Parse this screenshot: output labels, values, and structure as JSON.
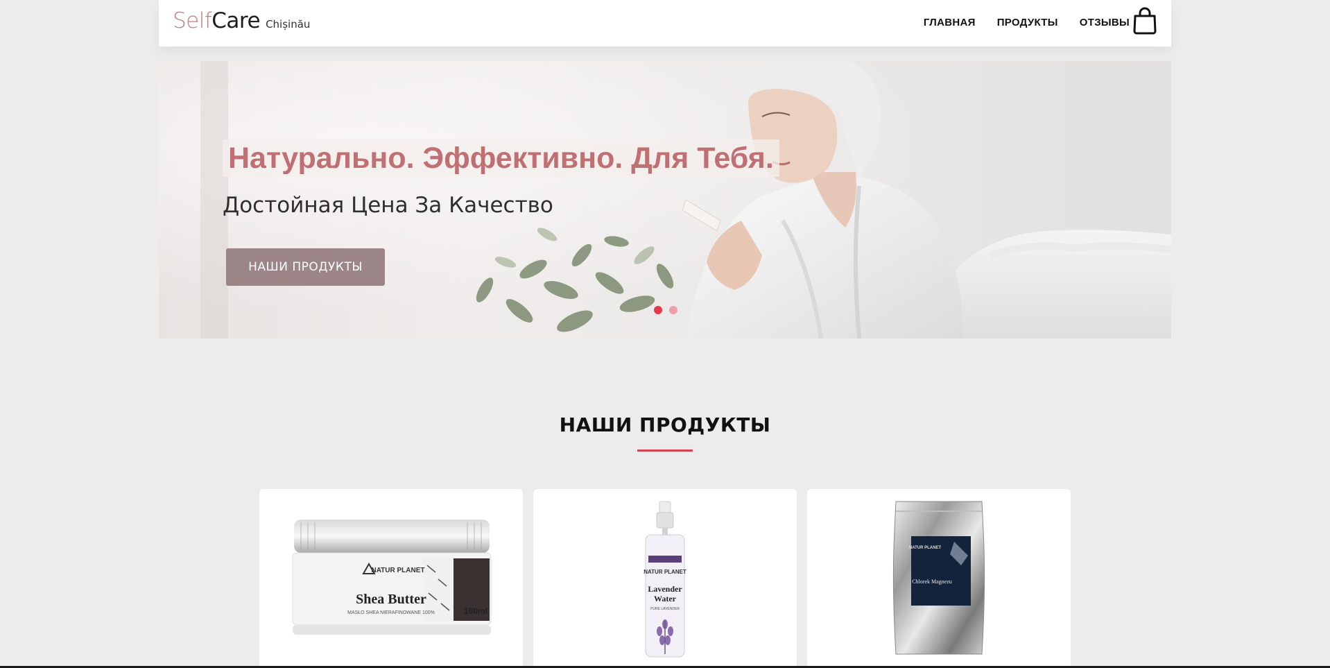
{
  "header": {
    "logo_self": "Self",
    "logo_care": "Care",
    "logo_city": "Chișinău",
    "nav": [
      "ГЛАВНАЯ",
      "ПРОДУКТЫ",
      "ОТЗЫВЫ"
    ],
    "cart_icon": "shopping-bag-icon"
  },
  "hero": {
    "title": "Натурально. Эффективно. Для Тебя.",
    "subtitle": "Достойная Цена За Качество",
    "button": "НАШИ ПРОДУКТЫ",
    "slides_total": 2,
    "active_slide": 1
  },
  "products_section": {
    "title": "НАШИ ПРОДУКТЫ"
  },
  "products": [
    {
      "brand": "NATUR PLANET",
      "name": "Shea Butter",
      "subtitle": "MASŁO SHEA NIERAFINOWANE 100%",
      "volume": "100ml"
    },
    {
      "brand": "NATUR PLANET",
      "name_line1": "Lavender",
      "name_line2": "Water",
      "subtitle": "PURE LAVENDER"
    },
    {
      "brand": "NATUR PLANET",
      "name": "Chlorek Magnezu"
    }
  ],
  "colors": {
    "accent": "#c06f72",
    "button": "#9c8587",
    "underline": "#d64350",
    "dot_active": "#e53a4a",
    "dot_inactive": "#e9a0a8"
  }
}
